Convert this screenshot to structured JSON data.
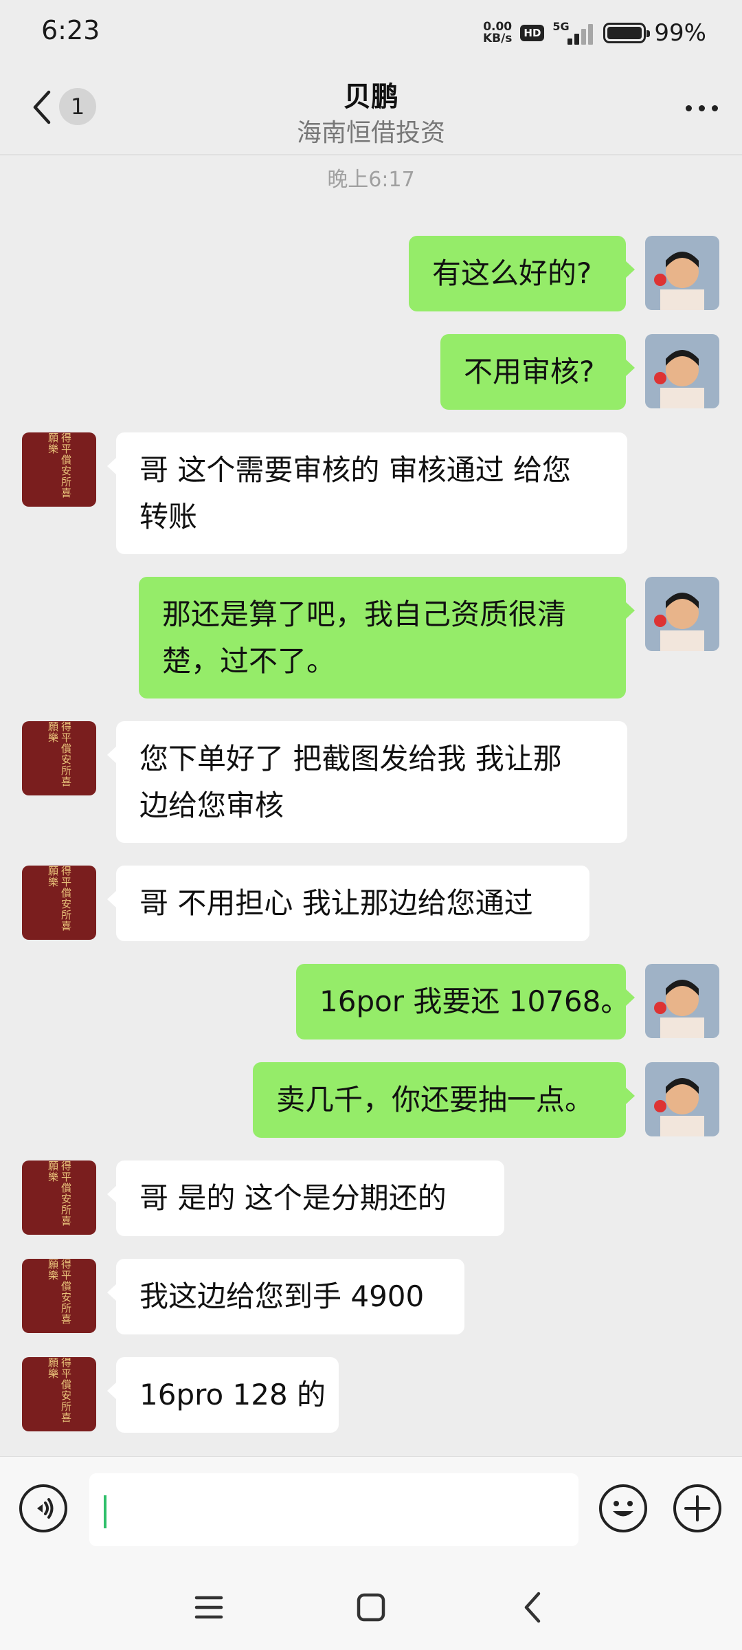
{
  "status_bar": {
    "time": "6:23",
    "net_speed_value": "0.00",
    "net_speed_unit": "KB/s",
    "hd_label": "HD",
    "network_type": "5G",
    "battery_level": 0.99,
    "battery_text": "99%"
  },
  "header": {
    "unread_count": "1",
    "title": "贝鹏",
    "subtitle": "海南恒借投资",
    "back_icon": "back-chevron-icon",
    "more_icon": "more-dots-icon"
  },
  "timestamp": "晚上6:17",
  "messages": [
    {
      "side": "right",
      "lines": [
        "有这么好的?"
      ]
    },
    {
      "side": "right",
      "lines": [
        "不用审核?"
      ]
    },
    {
      "side": "left",
      "lines": [
        "哥 这个需要审核的 审核通过 给您",
        "转账"
      ]
    },
    {
      "side": "right",
      "lines": [
        "那还是算了吧，我自己资质很清",
        "楚，过不了。"
      ]
    },
    {
      "side": "left",
      "lines": [
        "您下单好了 把截图发给我 我让那",
        "边给您审核"
      ]
    },
    {
      "side": "left",
      "lines": [
        "哥 不用担心 我让那边给您通过"
      ]
    },
    {
      "side": "right",
      "lines": [
        "16por 我要还 10768。"
      ]
    },
    {
      "side": "right",
      "lines": [
        "卖几千，你还要抽一点。"
      ]
    },
    {
      "side": "left",
      "lines": [
        "哥 是的 这个是分期还的"
      ]
    },
    {
      "side": "left",
      "lines": [
        "我这边给您到手 4900"
      ]
    },
    {
      "side": "left",
      "lines": [
        "16pro 128 的"
      ]
    }
  ],
  "contact_avatar_seal": "得平償安所喜願樂",
  "input_bar": {
    "voice_icon": "voice-icon",
    "emoji_icon": "emoji-icon",
    "plus_icon": "plus-icon",
    "input_value": ""
  },
  "nav_bar": {
    "menu_icon": "menu-icon",
    "home_icon": "home-square-icon",
    "back_icon": "nav-back-icon"
  },
  "colors": {
    "background": "#ededed",
    "bubble_right": "#95ec69",
    "bubble_left": "#ffffff",
    "caret": "#2fbf6a"
  }
}
